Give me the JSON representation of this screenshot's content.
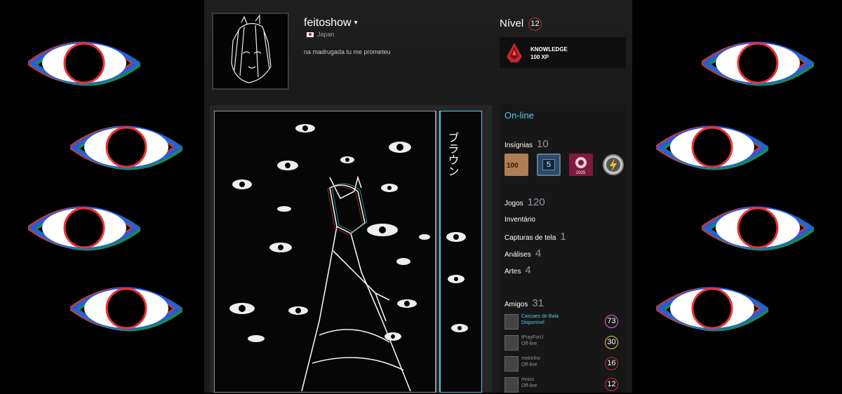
{
  "profile": {
    "persona_name": "feitoshow",
    "persona_caret": "▾",
    "country": "Japan",
    "summary": "na madrugada tu me prometeu",
    "level_label": "Nível",
    "level": "12"
  },
  "featured_badge": {
    "title": "KNOWLEDGE",
    "xp": "100 XP",
    "icon": "knowledge-badge-icon"
  },
  "right_panel": {
    "status": "On-line",
    "badges": {
      "label": "Insígnias",
      "count": "10"
    },
    "badge_icons": [
      {
        "icon": "badge-100-icon",
        "text": "100"
      },
      {
        "icon": "badge-years-5-icon",
        "text": "5"
      },
      {
        "icon": "badge-steam-2025-icon",
        "text": "2025"
      },
      {
        "icon": "badge-lightning-icon",
        "text": ""
      }
    ],
    "games": {
      "label": "Jogos",
      "count": "120"
    },
    "inventory": {
      "label": "Inventário"
    },
    "screenshots": {
      "label": "Capturas de tela",
      "count": "1"
    },
    "reviews": {
      "label": "Análises",
      "count": "4"
    },
    "artwork": {
      "label": "Artes",
      "count": "4"
    },
    "friends": {
      "label": "Amigos",
      "count": "31"
    },
    "friend_list": [
      {
        "name": "Cascaes de Bala",
        "status": "Disponível",
        "level": "73",
        "level_color": "#e36bd9"
      },
      {
        "name": "iPrayForU",
        "status": "Off-line",
        "level": "30",
        "level_color": "#e8c93a"
      },
      {
        "name": "meirinho",
        "status": "Off-line",
        "level": "16",
        "level_color": "#c13037"
      },
      {
        "name": "mnizz",
        "status": "Off-line",
        "level": "12",
        "level_color": "#c13037"
      }
    ]
  },
  "colors": {
    "accent_online": "#57cbde",
    "level_ring": "#c13037",
    "page_bg": "#1b1b1c"
  },
  "artwork_text": "ブラウン"
}
